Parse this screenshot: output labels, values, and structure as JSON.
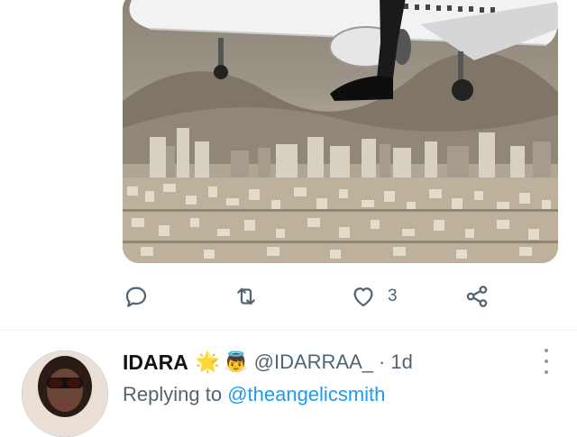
{
  "media": {
    "description_icon": "photo-media",
    "colors": {
      "sky": "#8c8377",
      "building": "#d9d2c3",
      "plane": "#f2f2f2"
    }
  },
  "actions": {
    "reply_icon": "reply-icon",
    "retweet_icon": "retweet-icon",
    "like_icon": "heart-icon",
    "like_count": "3",
    "share_icon": "share-icon",
    "icon_color": "#536471"
  },
  "reply_tweet": {
    "author_name": "IDARA",
    "badge_emoji_1": "🌟",
    "badge_emoji_2": "👼",
    "handle": "@IDARRAA_",
    "separator": "·",
    "time": "1d",
    "replying_to_prefix": "Replying to",
    "replying_to_handle": "@theangelicsmith",
    "link_color": "#1d9bf0"
  }
}
